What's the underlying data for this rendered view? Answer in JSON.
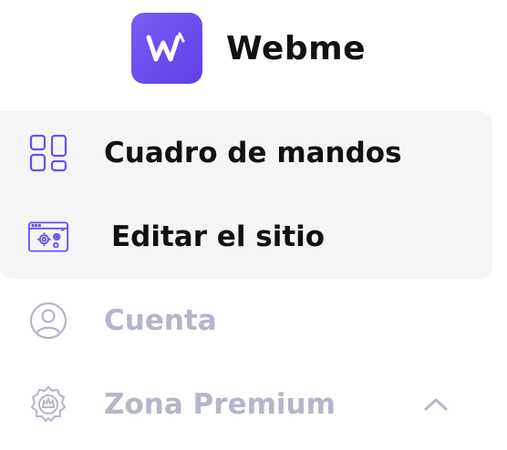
{
  "brand": {
    "name": "Webme",
    "logo_icon": "webme-w-logo",
    "logo_color": "#6a4ef0"
  },
  "nav": {
    "items": [
      {
        "label": "Cuadro de mandos",
        "icon": "dashboard-grid-icon",
        "state": "active"
      },
      {
        "label": "Editar el sitio",
        "icon": "site-settings-icon",
        "state": "active"
      },
      {
        "label": "Cuenta",
        "icon": "user-circle-icon",
        "state": "inactive"
      },
      {
        "label": "Zona Premium",
        "icon": "premium-badge-icon",
        "state": "inactive",
        "expand_icon": "chevron-up-icon"
      }
    ]
  },
  "colors": {
    "accent": "#6a4ef0",
    "active_bg": "#f5f5f8",
    "muted": "#b4b6c9",
    "text": "#111111"
  }
}
